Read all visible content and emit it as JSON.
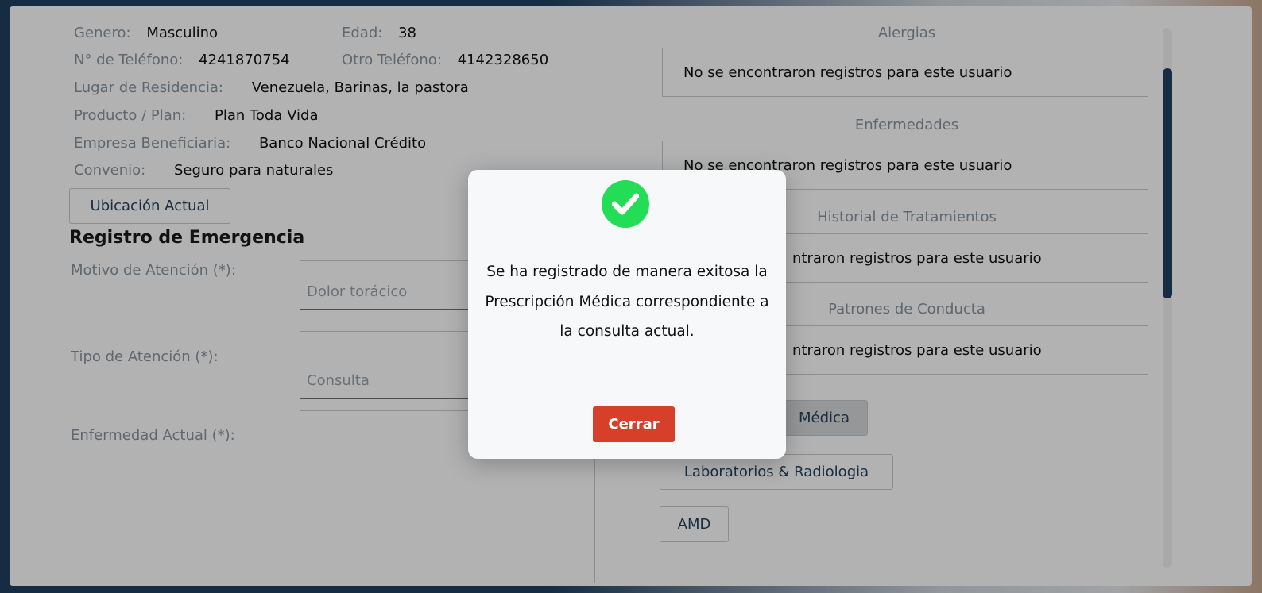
{
  "patient": {
    "genero_label": "Genero:",
    "genero": "Masculino",
    "edad_label": "Edad:",
    "edad": "38",
    "tel_label": "N° de Teléfono:",
    "tel": "4241870754",
    "otro_tel_label": "Otro Teléfono:",
    "otro_tel": "4142328650",
    "residencia_label": "Lugar de Residencia:",
    "residencia": "Venezuela, Barinas, la pastora",
    "plan_label": "Producto / Plan:",
    "plan": "Plan Toda Vida",
    "empresa_label": "Empresa Beneficiaria:",
    "empresa": "Banco Nacional Crédito",
    "convenio_label": "Convenio:",
    "convenio": "Seguro para naturales"
  },
  "ubicacion_button": "Ubicación Actual",
  "emergency": {
    "title": "Registro de Emergencia",
    "motivo_label": "Motivo de Atención (*):",
    "motivo_value": "Dolor torácico",
    "tipo_label": "Tipo de Atención (*):",
    "tipo_value": "Consulta",
    "enfermedad_label": "Enfermedad Actual (*):"
  },
  "right": {
    "alergias_title": "Alergias",
    "enfermedades_title": "Enfermedades",
    "historial_title": "Historial de Tratamientos",
    "patrones_title": "Patrones de Conducta",
    "no_records": "No se encontraron registros para este usuario",
    "no_records_partial": "ntraron registros para este usuario",
    "prescripcion_partial": "Médica",
    "laboratorios_button": "Laboratorios & Radiologia",
    "amd_button": "AMD"
  },
  "modal": {
    "message": "Se ha registrado de manera exitosa la Prescripción Médica correspondiente a la consulta actual.",
    "close_label": "Cerrar",
    "check_color": "#22dd55",
    "close_color": "#d6402b"
  }
}
